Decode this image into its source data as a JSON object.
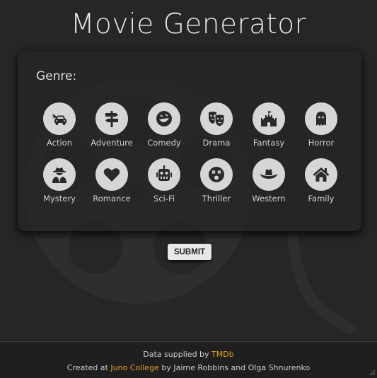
{
  "page": {
    "title": "Movie Generator"
  },
  "form": {
    "genre_label": "Genre:",
    "submit_label": "SUBMIT"
  },
  "genres": [
    {
      "label": "Action",
      "icon": "car-crash-icon"
    },
    {
      "label": "Adventure",
      "icon": "signpost-icon"
    },
    {
      "label": "Comedy",
      "icon": "laugh-icon"
    },
    {
      "label": "Drama",
      "icon": "theater-masks-icon"
    },
    {
      "label": "Fantasy",
      "icon": "castle-icon"
    },
    {
      "label": "Horror",
      "icon": "ghost-icon"
    },
    {
      "label": "Mystery",
      "icon": "spy-icon"
    },
    {
      "label": "Romance",
      "icon": "heart-icon"
    },
    {
      "label": "Sci-Fi",
      "icon": "robot-icon"
    },
    {
      "label": "Thriller",
      "icon": "dizzy-face-icon"
    },
    {
      "label": "Western",
      "icon": "cowboy-hat-icon"
    },
    {
      "label": "Family",
      "icon": "home-icon"
    }
  ],
  "footer": {
    "line1_prefix": "Data supplied by ",
    "line1_link": "TMDb",
    "line2_prefix": "Created at ",
    "line2_link": "Juno College",
    "line2_suffix": " by Jaime Robbins and Olga Shnurenko"
  },
  "colors": {
    "background": "#262626",
    "icon_circle": "#d6d6d6",
    "link": "#e0a020"
  }
}
